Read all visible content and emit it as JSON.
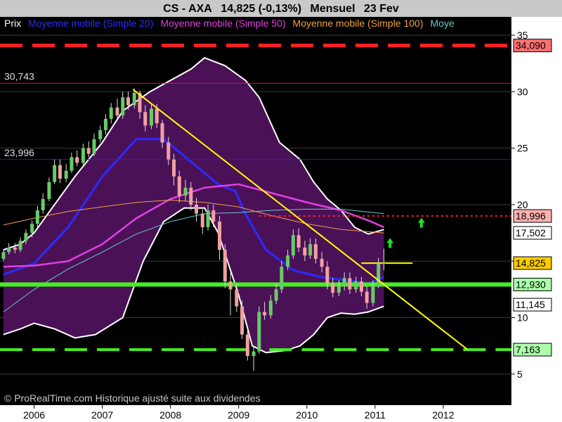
{
  "header": {
    "instrument": "CS - AXA",
    "price": "14,825 (-0,13%)",
    "period": "Mensuel",
    "date": "23 Fev"
  },
  "legend": [
    {
      "text": "Prix",
      "color": "#ffffff"
    },
    {
      "text": "Moyenne mobile (Simple 20)",
      "color": "#2b2bff"
    },
    {
      "text": "Moyenne mobile (Simple 50)",
      "color": "#e040e0"
    },
    {
      "text": "Moyenne mobile (Simple 100)",
      "color": "#f0a040"
    },
    {
      "text": "Moye",
      "color": "#66cccc"
    }
  ],
  "watermark": "© ProRealTime.com Historique ajusté suite aux dividendes",
  "colors": {
    "background": "#000000",
    "band_fill": "#4b1157",
    "band_edge": "#ffffff",
    "bull_candle": "#66cc66",
    "bear_candle": "#f0a0a0",
    "support": "#44ee22",
    "resistance": "#ff2020",
    "trendline": "#ffff00"
  },
  "chart_data": {
    "type": "candlestick",
    "title": "CS - AXA",
    "x": {
      "ticks": [
        "2006",
        "2007",
        "2008",
        "2009",
        "2010",
        "2011",
        "2012"
      ],
      "range": [
        2005.5,
        2013.0
      ]
    },
    "y": {
      "ticks": [
        "5",
        "10",
        "15",
        "20",
        "25",
        "30",
        "35"
      ],
      "range": [
        2.5,
        36.0
      ],
      "side": "right"
    },
    "candles": [
      [
        2005.55,
        15.2,
        15.8,
        15.0,
        16.0
      ],
      [
        2005.63,
        15.8,
        16.2,
        15.6,
        16.6
      ],
      [
        2005.72,
        16.2,
        16.0,
        15.7,
        16.6
      ],
      [
        2005.8,
        16.0,
        16.8,
        15.8,
        17.1
      ],
      [
        2005.88,
        16.8,
        17.5,
        16.5,
        17.8
      ],
      [
        2005.97,
        17.5,
        18.3,
        17.1,
        18.6
      ],
      [
        2006.05,
        18.3,
        19.5,
        18.0,
        19.9
      ],
      [
        2006.13,
        19.5,
        20.5,
        19.2,
        21.0
      ],
      [
        2006.22,
        20.5,
        22.0,
        20.3,
        22.4
      ],
      [
        2006.3,
        22.0,
        23.5,
        21.8,
        24.0
      ],
      [
        2006.38,
        23.5,
        22.3,
        21.9,
        24.0
      ],
      [
        2006.47,
        22.3,
        23.0,
        22.0,
        23.6
      ],
      [
        2006.55,
        23.0,
        24.2,
        22.8,
        24.6
      ],
      [
        2006.63,
        24.2,
        23.7,
        23.4,
        24.8
      ],
      [
        2006.72,
        23.7,
        25.0,
        23.5,
        25.4
      ],
      [
        2006.8,
        25.0,
        24.5,
        24.2,
        25.6
      ],
      [
        2006.88,
        24.5,
        25.8,
        24.3,
        26.3
      ],
      [
        2006.97,
        25.8,
        26.6,
        25.5,
        27.0
      ],
      [
        2007.05,
        26.6,
        27.6,
        26.2,
        28.0
      ],
      [
        2007.13,
        27.6,
        28.6,
        27.2,
        29.0
      ],
      [
        2007.22,
        28.6,
        27.9,
        27.5,
        29.4
      ],
      [
        2007.3,
        27.9,
        29.5,
        27.6,
        30.0
      ],
      [
        2007.38,
        29.5,
        28.8,
        28.4,
        30.0
      ],
      [
        2007.47,
        28.8,
        29.9,
        28.5,
        30.3
      ],
      [
        2007.55,
        29.9,
        28.2,
        27.6,
        30.1
      ],
      [
        2007.63,
        28.2,
        27.0,
        26.5,
        28.8
      ],
      [
        2007.72,
        27.0,
        28.5,
        26.7,
        29.0
      ],
      [
        2007.8,
        28.5,
        27.2,
        26.8,
        28.9
      ],
      [
        2007.88,
        27.2,
        25.5,
        25.0,
        27.5
      ],
      [
        2007.97,
        25.5,
        24.0,
        23.5,
        26.0
      ],
      [
        2008.05,
        24.0,
        22.5,
        21.7,
        24.5
      ],
      [
        2008.13,
        22.5,
        20.8,
        20.2,
        23.0
      ],
      [
        2008.22,
        20.8,
        21.5,
        20.3,
        22.2
      ],
      [
        2008.3,
        21.5,
        20.0,
        19.5,
        22.0
      ],
      [
        2008.38,
        20.0,
        19.2,
        18.5,
        20.6
      ],
      [
        2008.47,
        19.2,
        18.0,
        17.4,
        19.6
      ],
      [
        2008.55,
        18.0,
        19.5,
        17.7,
        20.0
      ],
      [
        2008.63,
        19.5,
        18.5,
        18.0,
        20.0
      ],
      [
        2008.72,
        18.5,
        16.0,
        15.1,
        19.0
      ],
      [
        2008.8,
        16.0,
        13.2,
        12.6,
        16.5
      ],
      [
        2008.88,
        13.2,
        12.5,
        10.2,
        14.0
      ],
      [
        2008.97,
        12.5,
        11.0,
        10.5,
        13.0
      ],
      [
        2009.05,
        11.0,
        8.5,
        8.1,
        11.5
      ],
      [
        2009.13,
        8.5,
        6.6,
        6.2,
        9.0
      ],
      [
        2009.22,
        6.6,
        7.0,
        5.3,
        7.4
      ],
      [
        2009.3,
        7.0,
        10.5,
        6.8,
        11.0
      ],
      [
        2009.38,
        10.5,
        10.2,
        9.8,
        11.4
      ],
      [
        2009.47,
        10.2,
        11.5,
        9.9,
        12.0
      ],
      [
        2009.55,
        11.5,
        12.5,
        11.2,
        13.0
      ],
      [
        2009.63,
        12.5,
        14.5,
        12.2,
        15.0
      ],
      [
        2009.72,
        14.5,
        15.5,
        14.2,
        16.0
      ],
      [
        2009.8,
        15.5,
        17.3,
        15.2,
        17.8
      ],
      [
        2009.88,
        17.3,
        16.2,
        15.8,
        17.9
      ],
      [
        2009.97,
        16.2,
        15.5,
        15.0,
        16.8
      ],
      [
        2010.05,
        15.5,
        16.5,
        15.2,
        17.0
      ],
      [
        2010.13,
        16.5,
        15.2,
        14.8,
        17.0
      ],
      [
        2010.22,
        15.2,
        14.5,
        14.0,
        15.8
      ],
      [
        2010.3,
        14.5,
        13.0,
        12.5,
        15.0
      ],
      [
        2010.38,
        13.0,
        12.2,
        11.8,
        13.5
      ],
      [
        2010.47,
        12.2,
        12.8,
        11.9,
        13.3
      ],
      [
        2010.55,
        12.8,
        13.5,
        12.4,
        14.0
      ],
      [
        2010.63,
        13.5,
        12.5,
        12.1,
        14.0
      ],
      [
        2010.72,
        12.5,
        13.2,
        12.2,
        13.6
      ],
      [
        2010.8,
        13.2,
        12.3,
        11.9,
        13.6
      ],
      [
        2010.88,
        12.3,
        11.3,
        10.8,
        12.8
      ],
      [
        2010.97,
        11.3,
        12.8,
        11.0,
        13.3
      ],
      [
        2011.05,
        12.8,
        14.8,
        12.6,
        15.3
      ],
      [
        2011.13,
        14.8,
        14.825,
        14.2,
        16.1
      ]
    ],
    "moving_averages": [
      {
        "name": "Moyenne mobile (Simple 20)",
        "color": "#2b2bff",
        "points": [
          [
            2005.55,
            13.8
          ],
          [
            2006.0,
            14.8
          ],
          [
            2006.5,
            18.0
          ],
          [
            2007.0,
            22.5
          ],
          [
            2007.5,
            25.8
          ],
          [
            2007.9,
            25.8
          ],
          [
            2008.3,
            23.8
          ],
          [
            2008.7,
            21.8
          ],
          [
            2008.95,
            21.2
          ],
          [
            2009.1,
            19.2
          ],
          [
            2009.4,
            16.0
          ],
          [
            2009.8,
            14.2
          ],
          [
            2010.2,
            13.6
          ],
          [
            2010.6,
            13.3
          ],
          [
            2010.9,
            13.0
          ],
          [
            2011.13,
            13.6
          ]
        ]
      },
      {
        "name": "Moyenne mobile (Simple 50)",
        "color": "#e040e0",
        "points": [
          [
            2005.55,
            14.5
          ],
          [
            2006.0,
            14.6
          ],
          [
            2006.5,
            15.0
          ],
          [
            2007.0,
            16.5
          ],
          [
            2007.5,
            18.8
          ],
          [
            2008.0,
            20.5
          ],
          [
            2008.5,
            21.5
          ],
          [
            2009.0,
            21.8
          ],
          [
            2009.5,
            21.0
          ],
          [
            2010.0,
            20.2
          ],
          [
            2010.5,
            19.5
          ],
          [
            2010.9,
            18.6
          ],
          [
            2011.13,
            18.0
          ]
        ]
      },
      {
        "name": "Moyenne mobile (Simple 100)",
        "color": "#f0a040",
        "points": [
          [
            2005.55,
            18.2
          ],
          [
            2006.0,
            18.8
          ],
          [
            2006.5,
            19.4
          ],
          [
            2007.0,
            19.8
          ],
          [
            2007.5,
            20.2
          ],
          [
            2008.0,
            20.4
          ],
          [
            2008.5,
            20.2
          ],
          [
            2009.0,
            19.8
          ],
          [
            2009.5,
            19.0
          ],
          [
            2010.0,
            18.3
          ],
          [
            2010.5,
            17.8
          ],
          [
            2011.13,
            17.5
          ]
        ]
      },
      {
        "name": "Moye",
        "color": "#66cccc",
        "points": [
          [
            2005.55,
            10.5
          ],
          [
            2006.0,
            12.5
          ],
          [
            2006.5,
            14.3
          ],
          [
            2007.0,
            15.8
          ],
          [
            2007.5,
            17.4
          ],
          [
            2008.0,
            18.5
          ],
          [
            2008.5,
            19.2
          ],
          [
            2009.0,
            19.3
          ],
          [
            2009.5,
            19.5
          ],
          [
            2010.0,
            19.6
          ],
          [
            2010.5,
            19.6
          ],
          [
            2011.13,
            19.2
          ]
        ]
      }
    ],
    "bollinger": {
      "upper": [
        [
          2005.55,
          16.0
        ],
        [
          2005.8,
          16.5
        ],
        [
          2006.0,
          17.5
        ],
        [
          2006.3,
          20.0
        ],
        [
          2006.6,
          22.5
        ],
        [
          2007.0,
          25.5
        ],
        [
          2007.3,
          28.3
        ],
        [
          2007.7,
          30.0
        ],
        [
          2008.0,
          31.0
        ],
        [
          2008.3,
          32.0
        ],
        [
          2008.5,
          33.0
        ],
        [
          2008.8,
          32.3
        ],
        [
          2009.1,
          31.0
        ],
        [
          2009.3,
          29.5
        ],
        [
          2009.6,
          25.5
        ],
        [
          2009.9,
          24.0
        ],
        [
          2010.1,
          22.0
        ],
        [
          2010.3,
          20.5
        ],
        [
          2010.5,
          19.5
        ],
        [
          2010.7,
          18.0
        ],
        [
          2010.9,
          17.4
        ],
        [
          2011.13,
          17.8
        ]
      ],
      "lower": [
        [
          2005.55,
          8.5
        ],
        [
          2005.8,
          9.0
        ],
        [
          2006.0,
          9.5
        ],
        [
          2006.3,
          9.0
        ],
        [
          2006.6,
          8.2
        ],
        [
          2006.9,
          8.5
        ],
        [
          2007.3,
          10.0
        ],
        [
          2007.6,
          15.0
        ],
        [
          2007.9,
          18.5
        ],
        [
          2008.2,
          19.7
        ],
        [
          2008.5,
          19.7
        ],
        [
          2008.7,
          17.5
        ],
        [
          2009.0,
          12.0
        ],
        [
          2009.2,
          7.5
        ],
        [
          2009.4,
          6.9
        ],
        [
          2009.7,
          7.1
        ],
        [
          2009.9,
          7.5
        ],
        [
          2010.1,
          8.5
        ],
        [
          2010.3,
          10.0
        ],
        [
          2010.5,
          10.4
        ],
        [
          2010.7,
          10.3
        ],
        [
          2010.9,
          10.5
        ],
        [
          2011.13,
          11.0
        ]
      ]
    },
    "horizontal_levels": [
      {
        "value": 34.09,
        "label": "34,090",
        "style": "dashed",
        "color": "#ff2020",
        "label_bg": "#ff7070"
      },
      {
        "value": 30.743,
        "label": "30,743",
        "style": "thin",
        "color": "#cc2222",
        "label_side": "left"
      },
      {
        "value": 23.996,
        "label": "23,996",
        "style": "thin",
        "color": "#2222cc",
        "label_side": "left"
      },
      {
        "value": 18.996,
        "label": "18,996",
        "style": "dotted",
        "color": "#ff2020",
        "label_bg": "#ffb0b0"
      },
      {
        "value": 17.502,
        "label": "17,502",
        "style": "none",
        "color": "#ffffff",
        "label_bg": "#ffffff"
      },
      {
        "value": 14.825,
        "label": "14,825",
        "style": "short",
        "color": "#ffff00",
        "label_bg": "#ffcc00"
      },
      {
        "value": 12.93,
        "label": "12,930",
        "style": "thick",
        "color": "#44ee22",
        "label_bg": "#aaffaa"
      },
      {
        "value": 11.145,
        "label": "11,145",
        "style": "none",
        "color": "#ffffff",
        "label_bg": "#ffffff"
      },
      {
        "value": 7.163,
        "label": "7,163",
        "style": "dashed-green",
        "color": "#44ee22",
        "label_bg": "#aaffaa"
      }
    ],
    "trendlines": [
      {
        "from": [
          2007.45,
          30.2
        ],
        "to": [
          2012.35,
          7.2
        ],
        "color": "#ffff00"
      }
    ],
    "arrows": [
      {
        "x": 2011.22,
        "y": 16.6,
        "color": "#22dd22"
      },
      {
        "x": 2011.68,
        "y": 18.4,
        "color": "#22dd22"
      }
    ]
  }
}
